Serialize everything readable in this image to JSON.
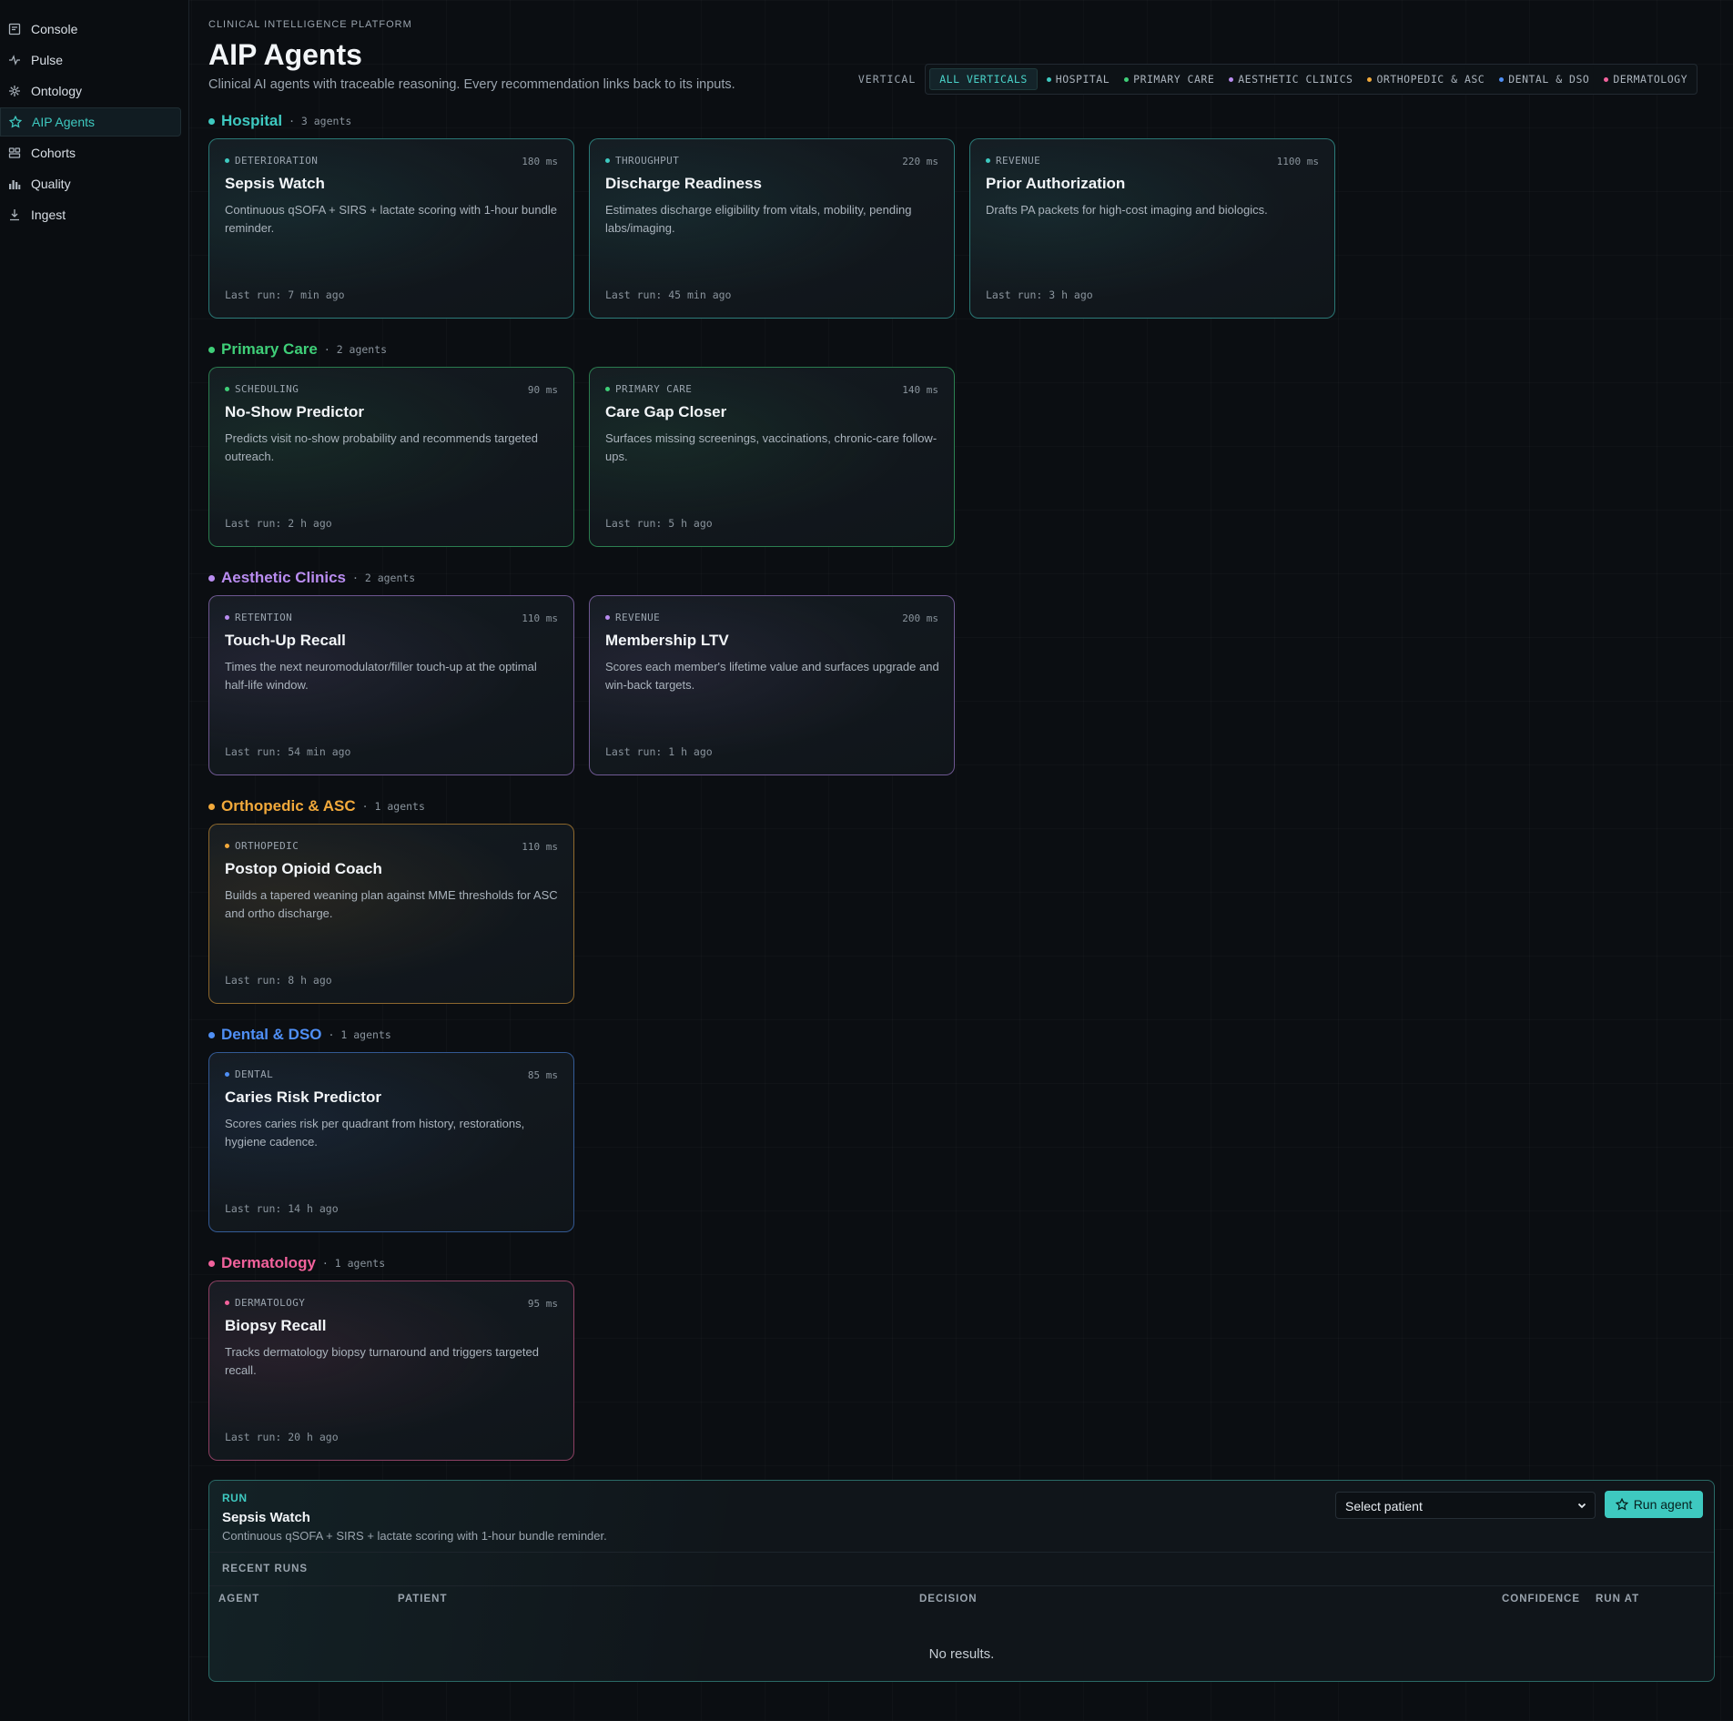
{
  "sidebar": {
    "items": [
      {
        "label": "Console",
        "icon": "console-icon"
      },
      {
        "label": "Pulse",
        "icon": "pulse-icon"
      },
      {
        "label": "Ontology",
        "icon": "ontology-icon"
      },
      {
        "label": "AIP Agents",
        "icon": "star-icon",
        "active": true
      },
      {
        "label": "Cohorts",
        "icon": "cohorts-icon"
      },
      {
        "label": "Quality",
        "icon": "bar-chart-icon"
      },
      {
        "label": "Ingest",
        "icon": "download-icon"
      }
    ]
  },
  "header": {
    "eyebrow": "CLINICAL INTELLIGENCE PLATFORM",
    "title": "AIP Agents",
    "subtitle": "Clinical AI agents with traceable reasoning. Every recommendation links back to its inputs."
  },
  "filter": {
    "label": "VERTICAL",
    "chips": [
      {
        "label": "ALL VERTICALS",
        "active": true
      },
      {
        "label": "HOSPITAL",
        "color": "#3ec9c0"
      },
      {
        "label": "PRIMARY CARE",
        "color": "#3fcf78"
      },
      {
        "label": "AESTHETIC CLINICS",
        "color": "#b98cf0"
      },
      {
        "label": "ORTHOPEDIC & ASC",
        "color": "#f2a93b"
      },
      {
        "label": "DENTAL & DSO",
        "color": "#4f8ff5"
      },
      {
        "label": "DERMATOLOGY",
        "color": "#f2629c"
      }
    ]
  },
  "sections": [
    {
      "title": "Hospital",
      "count": "· 3 agents",
      "color": "#3ec9c0",
      "cards": [
        {
          "tag": "DETERIORATION",
          "ms": "180 ms",
          "title": "Sepsis Watch",
          "desc": "Continuous qSOFA + SIRS + lactate scoring with 1-hour bundle reminder.",
          "last_run": "Last run: 7 min ago"
        },
        {
          "tag": "THROUGHPUT",
          "ms": "220 ms",
          "title": "Discharge Readiness",
          "desc": "Estimates discharge eligibility from vitals, mobility, pending labs/imaging.",
          "last_run": "Last run: 45 min ago"
        },
        {
          "tag": "REVENUE",
          "ms": "1100 ms",
          "title": "Prior Authorization",
          "desc": "Drafts PA packets for high-cost imaging and biologics.",
          "last_run": "Last run: 3 h ago"
        }
      ]
    },
    {
      "title": "Primary Care",
      "count": "· 2 agents",
      "color": "#3fcf78",
      "cards": [
        {
          "tag": "SCHEDULING",
          "ms": "90 ms",
          "title": "No-Show Predictor",
          "desc": "Predicts visit no-show probability and recommends targeted outreach.",
          "last_run": "Last run: 2 h ago"
        },
        {
          "tag": "PRIMARY CARE",
          "ms": "140 ms",
          "title": "Care Gap Closer",
          "desc": "Surfaces missing screenings, vaccinations, chronic-care follow-ups.",
          "last_run": "Last run: 5 h ago"
        }
      ]
    },
    {
      "title": "Aesthetic Clinics",
      "count": "· 2 agents",
      "color": "#b98cf0",
      "cards": [
        {
          "tag": "RETENTION",
          "ms": "110 ms",
          "title": "Touch-Up Recall",
          "desc": "Times the next neuromodulator/filler touch-up at the optimal half-life window.",
          "last_run": "Last run: 54 min ago"
        },
        {
          "tag": "REVENUE",
          "ms": "200 ms",
          "title": "Membership LTV",
          "desc": "Scores each member's lifetime value and surfaces upgrade and win-back targets.",
          "last_run": "Last run: 1 h ago"
        }
      ]
    },
    {
      "title": "Orthopedic & ASC",
      "count": "· 1 agents",
      "color": "#f2a93b",
      "cards": [
        {
          "tag": "ORTHOPEDIC",
          "ms": "110 ms",
          "title": "Postop Opioid Coach",
          "desc": "Builds a tapered weaning plan against MME thresholds for ASC and ortho discharge.",
          "last_run": "Last run: 8 h ago"
        }
      ]
    },
    {
      "title": "Dental & DSO",
      "count": "· 1 agents",
      "color": "#4f8ff5",
      "cards": [
        {
          "tag": "DENTAL",
          "ms": "85 ms",
          "title": "Caries Risk Predictor",
          "desc": "Scores caries risk per quadrant from history, restorations, hygiene cadence.",
          "last_run": "Last run: 14 h ago"
        }
      ]
    },
    {
      "title": "Dermatology",
      "count": "· 1 agents",
      "color": "#f2629c",
      "cards": [
        {
          "tag": "DERMATOLOGY",
          "ms": "95 ms",
          "title": "Biopsy Recall",
          "desc": "Tracks dermatology biopsy turnaround and triggers targeted recall.",
          "last_run": "Last run: 20 h ago"
        }
      ]
    }
  ],
  "run_panel": {
    "eyebrow": "RUN",
    "title": "Sepsis Watch",
    "desc": "Continuous qSOFA + SIRS + lactate scoring with 1-hour bundle reminder.",
    "select_value": "Select patient",
    "button_label": "Run agent",
    "recent_label": "RECENT RUNS",
    "columns": [
      "AGENT",
      "PATIENT",
      "DECISION",
      "CONFIDENCE",
      "RUN AT"
    ],
    "empty_text": "No results."
  }
}
